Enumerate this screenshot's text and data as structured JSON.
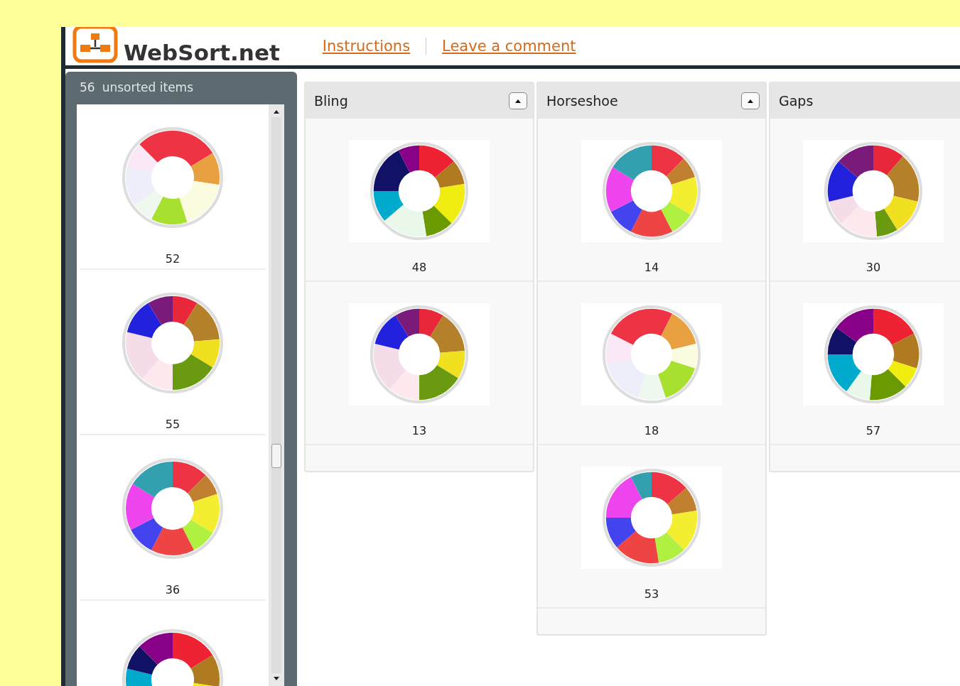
{
  "header": {
    "logo_text": "WebSort.net",
    "links": [
      "Instructions",
      "Leave a comment"
    ]
  },
  "unsorted": {
    "count": "56",
    "label": "unsorted items",
    "items": [
      {
        "number": "52",
        "cut_off": false
      },
      {
        "number": "55",
        "cut_off": false
      },
      {
        "number": "36",
        "cut_off": false
      },
      {
        "cut_off": true
      }
    ]
  },
  "groups": [
    {
      "title": "Bling",
      "collapsible": true,
      "items": [
        "48",
        "13"
      ]
    },
    {
      "title": "Horseshoe",
      "collapsible": true,
      "items": [
        "14",
        "18",
        "53"
      ]
    },
    {
      "title": "Gaps",
      "collapsible": false,
      "items": [
        "30",
        "57"
      ]
    }
  ]
}
